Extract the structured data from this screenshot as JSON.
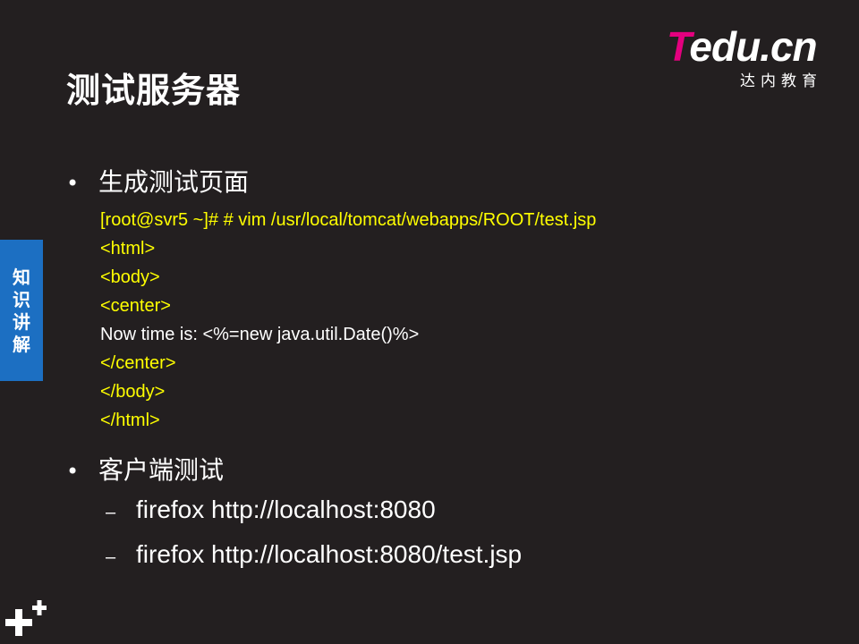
{
  "slide": {
    "title": "测试服务器",
    "logo": {
      "main_t": "T",
      "main_rest": "edu.cn",
      "sub": "达内教育"
    },
    "side_tab": "知识讲解",
    "bullets": [
      {
        "label": "生成测试页面",
        "code_lines": [
          "[root@svr5 ~]# # vim /usr/local/tomcat/webapps/ROOT/test.jsp",
          "<html>",
          "<body>",
          "<center>",
          "Now time is: <%=new java.util.Date()%>",
          "</center>",
          "</body>",
          "</html>"
        ]
      },
      {
        "label": "客户端测试",
        "sub_items": [
          "firefox http://localhost:8080",
          "firefox http://localhost:8080/test.jsp"
        ]
      }
    ],
    "bullet_glyph": "•",
    "dash_glyph": "–"
  },
  "colors": {
    "background": "#231f20",
    "accent_blue": "#1c6fc2",
    "code_yellow": "#ffff00",
    "logo_magenta": "#e4007f"
  }
}
